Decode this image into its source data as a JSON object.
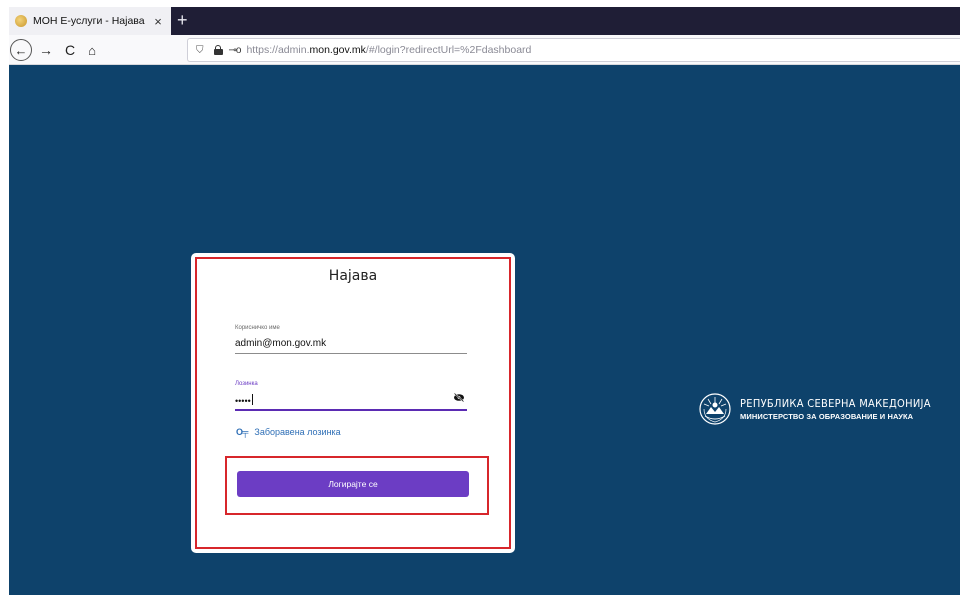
{
  "browser": {
    "tab": {
      "title": "МОН Е-услуги - Најава",
      "close_glyph": "×"
    },
    "new_tab_glyph": "+",
    "nav": {
      "back_glyph": "←",
      "forward_glyph": "→",
      "reload_glyph": "C",
      "home_glyph": "⌂"
    },
    "url": {
      "prefix": "https://admin.",
      "domain": "mon.gov.mk",
      "suffix": "/#/login?redirectUrl=%2Fdashboard"
    },
    "icons": {
      "shield": "shield-icon",
      "lock": "lock-icon",
      "key": "key-icon"
    }
  },
  "login": {
    "title": "Најава",
    "username_label": "Корисничко име",
    "username_value": "admin@mon.gov.mk",
    "password_label": "Лозинка",
    "password_value": "•••••",
    "forgot_password": "Заборавена лозинка",
    "submit_label": "Логирајте се"
  },
  "brand": {
    "line1": "РЕПУБЛИКА СЕВЕРНА МАКЕДОНИЈА",
    "line2": "МИНИСТЕРСТВО ЗА ОБРАЗОВАНИЕ И НАУКА"
  },
  "colors": {
    "background": "#0e426b",
    "accent": "#6c3dc4",
    "link": "#2f6fb6",
    "highlight": "#d7262b",
    "tabbar": "#1f1e36"
  }
}
